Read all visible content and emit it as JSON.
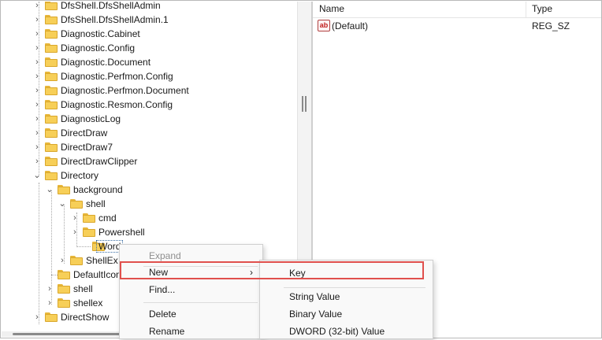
{
  "tree": {
    "nodes": [
      {
        "label": "DfsShell.DfsShellAdmin"
      },
      {
        "label": "DfsShell.DfsShellAdmin.1"
      },
      {
        "label": "Diagnostic.Cabinet"
      },
      {
        "label": "Diagnostic.Config"
      },
      {
        "label": "Diagnostic.Document"
      },
      {
        "label": "Diagnostic.Perfmon.Config"
      },
      {
        "label": "Diagnostic.Perfmon.Document"
      },
      {
        "label": "Diagnostic.Resmon.Config"
      },
      {
        "label": "DiagnosticLog"
      },
      {
        "label": "DirectDraw"
      },
      {
        "label": "DirectDraw7"
      },
      {
        "label": "DirectDrawClipper"
      },
      {
        "label": "Directory"
      },
      {
        "label": "background"
      },
      {
        "label": "shell"
      },
      {
        "label": "cmd"
      },
      {
        "label": "Powershell"
      },
      {
        "label": "Word"
      },
      {
        "label": "ShellEx"
      },
      {
        "label": "DefaultIcon"
      },
      {
        "label": "shell"
      },
      {
        "label": "shellex"
      },
      {
        "label": "DirectShow"
      }
    ]
  },
  "list": {
    "columns": {
      "name": "Name",
      "type": "Type"
    },
    "rows": [
      {
        "name": "(Default)",
        "type": "REG_SZ",
        "icon": "string-value-icon"
      }
    ]
  },
  "context_menu": {
    "items": [
      "Expand",
      "New",
      "Find...",
      "Delete",
      "Rename"
    ]
  },
  "submenu": {
    "items": [
      "Key",
      "String Value",
      "Binary Value",
      "DWORD (32-bit) Value"
    ]
  },
  "colors": {
    "highlight_border": "#e0504d",
    "folder": "#f7cf58"
  }
}
